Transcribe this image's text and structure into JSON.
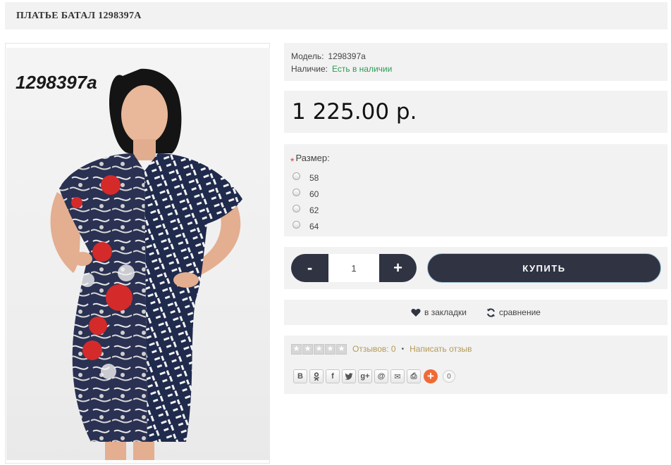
{
  "product": {
    "title": "ПЛАТЬЕ БАТАЛ 1298397А",
    "photo_code": "1298397a",
    "model_label": "Модель:",
    "model_value": "1298397a",
    "stock_label": "Наличие:",
    "stock_value": "Есть в наличии",
    "price": "1 225.00 р."
  },
  "options": {
    "required_mark": "*",
    "size_label": "Размер:",
    "sizes": [
      "58",
      "60",
      "62",
      "64"
    ]
  },
  "cart": {
    "minus": "-",
    "plus": "+",
    "quantity": "1",
    "buy_label": "КУПИТЬ"
  },
  "actions": {
    "wishlist_label": "в закладки",
    "compare_label": "сравнение"
  },
  "reviews": {
    "rating": 0,
    "count_label": "Отзывов: 0",
    "separator": "•",
    "write_label": "Написать отзыв"
  },
  "share": {
    "buttons": [
      {
        "icon": "vk-icon",
        "glyph": "В"
      },
      {
        "icon": "odnoklassniki-icon",
        "glyph": "ok"
      },
      {
        "icon": "facebook-icon",
        "glyph": "f"
      },
      {
        "icon": "twitter-icon",
        "glyph": "t"
      },
      {
        "icon": "google-plus-icon",
        "glyph": "g+"
      },
      {
        "icon": "mail-at-icon",
        "glyph": "@"
      },
      {
        "icon": "email-icon",
        "glyph": "✉"
      },
      {
        "icon": "print-icon",
        "glyph": "⎙"
      }
    ],
    "more_glyph": "+",
    "count": "0"
  },
  "colors": {
    "panel_bg": "#f2f2f2",
    "button_dark": "#2f3342",
    "stock_green": "#2e9a55",
    "link_gold": "#b39a5a",
    "share_orange": "#f06a35"
  }
}
